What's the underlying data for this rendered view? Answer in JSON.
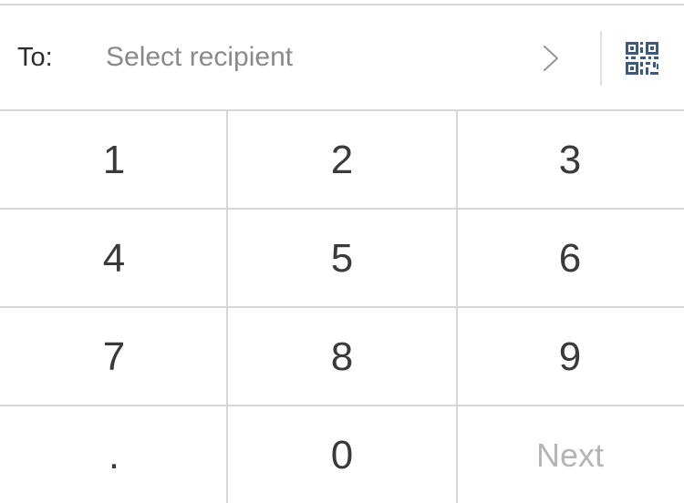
{
  "recipient": {
    "label": "To:",
    "placeholder": "Select recipient",
    "chevron_icon": "chevron-right-icon",
    "qr_icon": "qr-code-icon",
    "qr_color": "#3c5a80"
  },
  "keypad": {
    "keys": [
      "1",
      "2",
      "3",
      "4",
      "5",
      "6",
      "7",
      "8",
      "9",
      ".",
      "0",
      "Next"
    ]
  }
}
